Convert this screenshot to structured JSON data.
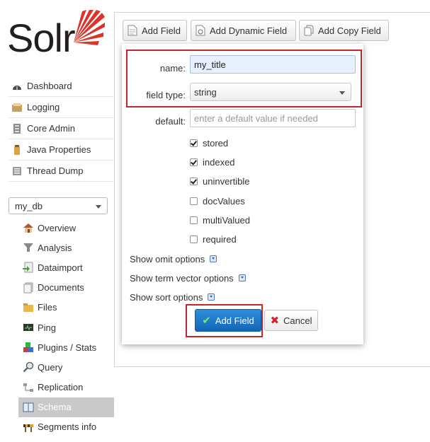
{
  "app": {
    "logo_text": "Solr"
  },
  "sidebar": {
    "items": [
      {
        "label": "Dashboard",
        "icon": "dashboard-icon"
      },
      {
        "label": "Logging",
        "icon": "logging-icon"
      },
      {
        "label": "Core Admin",
        "icon": "core-admin-icon"
      },
      {
        "label": "Java Properties",
        "icon": "java-icon"
      },
      {
        "label": "Thread Dump",
        "icon": "thread-dump-icon"
      }
    ],
    "core_selector": {
      "value": "my_db"
    },
    "core_items": [
      {
        "label": "Overview",
        "icon": "home-icon"
      },
      {
        "label": "Analysis",
        "icon": "funnel-icon"
      },
      {
        "label": "Dataimport",
        "icon": "dataimport-icon"
      },
      {
        "label": "Documents",
        "icon": "documents-icon"
      },
      {
        "label": "Files",
        "icon": "folder-icon"
      },
      {
        "label": "Ping",
        "icon": "ping-icon"
      },
      {
        "label": "Plugins / Stats",
        "icon": "plugins-icon"
      },
      {
        "label": "Query",
        "icon": "magnifier-icon"
      },
      {
        "label": "Replication",
        "icon": "replication-icon"
      },
      {
        "label": "Schema",
        "icon": "schema-icon",
        "active": true
      },
      {
        "label": "Segments info",
        "icon": "segments-icon"
      }
    ]
  },
  "toolbar": {
    "add_field": "Add Field",
    "add_dynamic_field": "Add Dynamic Field",
    "add_copy_field": "Add Copy Field"
  },
  "dialog": {
    "name_label": "name:",
    "name_value": "my_title",
    "type_label": "field type:",
    "type_value": "string",
    "default_label": "default:",
    "default_placeholder": "enter a default value if needed",
    "checkboxes": [
      {
        "label": "stored",
        "checked": true
      },
      {
        "label": "indexed",
        "checked": true
      },
      {
        "label": "uninvertible",
        "checked": true
      },
      {
        "label": "docValues",
        "checked": false
      },
      {
        "label": "multiValued",
        "checked": false
      },
      {
        "label": "required",
        "checked": false
      }
    ],
    "options": [
      "Show omit options",
      "Show term vector options",
      "Show sort options"
    ],
    "submit_label": "Add Field",
    "cancel_label": "Cancel"
  },
  "colors": {
    "highlight": "#c9262c",
    "primary_button": "#1f7ccc",
    "logo_red": "#d9352b"
  }
}
